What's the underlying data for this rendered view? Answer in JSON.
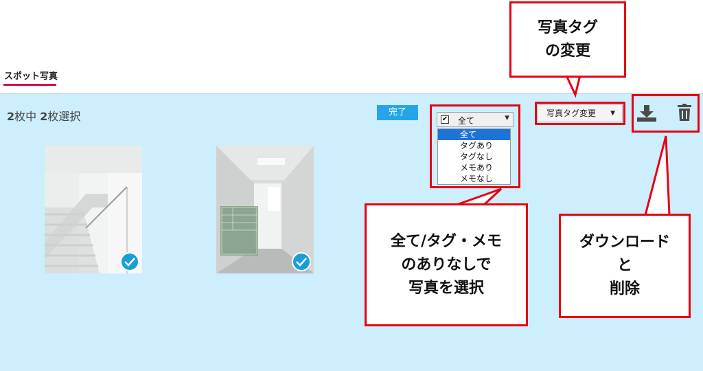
{
  "tab": {
    "label": "スポット写真"
  },
  "selection": {
    "n1": "2",
    "t1": "枚中 ",
    "n2": "2",
    "t2": "枚選択"
  },
  "toolbar": {
    "done_label": "完了",
    "filter_value": "全て",
    "filter_options": [
      "全て",
      "タグあり",
      "タグなし",
      "メモあり",
      "メモなし"
    ],
    "tag_change_label": "写真タグ変更",
    "download_icon": "download-icon",
    "delete_icon": "trash-icon"
  },
  "photos": [
    {
      "name": "stairwell-photo",
      "selected": true
    },
    {
      "name": "hallway-photo",
      "selected": true
    }
  ],
  "annotations": {
    "tag_change": "写真タグ\nの変更",
    "filter": "全て/タグ・メモ\nのありなしで\n写真を選択",
    "download_delete": "ダウンロード\nと\n削除"
  },
  "colors": {
    "accent": "#d5114d",
    "panel": "#cdeefc",
    "button": "#25a5e8",
    "callout_border": "#e60012"
  }
}
